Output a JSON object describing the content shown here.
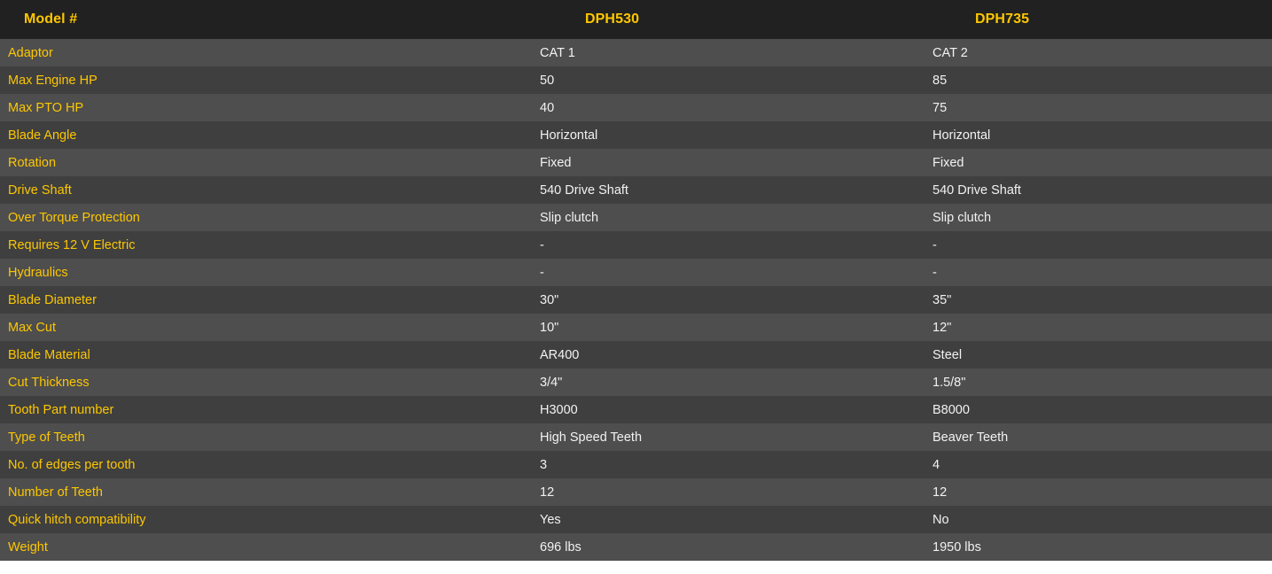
{
  "table": {
    "name": "model-specification-comparison",
    "colors": {
      "header_background": "#212121",
      "row_odd_background": "#4e4e4e",
      "row_even_background": "#3f3f3f",
      "label_text": "#fdc700",
      "value_text": "#f2f2f2",
      "page_background": "#ffffff"
    },
    "headers": {
      "label": "Model #",
      "value1": "DPH530",
      "value2": "DPH735"
    },
    "rows": [
      {
        "label": "Adaptor",
        "value1": "CAT 1",
        "value2": "CAT 2"
      },
      {
        "label": "Max Engine HP",
        "value1": "50",
        "value2": "85"
      },
      {
        "label": "Max PTO HP",
        "value1": "40",
        "value2": "75"
      },
      {
        "label": "Blade Angle",
        "value1": "Horizontal",
        "value2": "Horizontal"
      },
      {
        "label": "Rotation",
        "value1": "Fixed",
        "value2": "Fixed"
      },
      {
        "label": "Drive Shaft",
        "value1": "540 Drive Shaft",
        "value2": "540 Drive Shaft"
      },
      {
        "label": "Over Torque Protection",
        "value1": "Slip clutch",
        "value2": "Slip clutch"
      },
      {
        "label": "Requires 12 V Electric",
        "value1": "-",
        "value2": "-"
      },
      {
        "label": "Hydraulics",
        "value1": "-",
        "value2": "-"
      },
      {
        "label": "Blade Diameter",
        "value1": "30\"",
        "value2": "35\""
      },
      {
        "label": "Max Cut",
        "value1": "10\"",
        "value2": "12\""
      },
      {
        "label": "Blade Material",
        "value1": "AR400",
        "value2": "Steel"
      },
      {
        "label": "Cut Thickness",
        "value1": "3/4\"",
        "value2": "1.5/8\""
      },
      {
        "label": "Tooth Part number",
        "value1": "H3000",
        "value2": "B8000"
      },
      {
        "label": "Type of Teeth",
        "value1": "High Speed Teeth",
        "value2": "Beaver Teeth"
      },
      {
        "label": "No. of edges per tooth",
        "value1": "3",
        "value2": "4"
      },
      {
        "label": "Number of Teeth",
        "value1": "12",
        "value2": "12"
      },
      {
        "label": "Quick hitch compatibility",
        "value1": "Yes",
        "value2": "No"
      },
      {
        "label": "Weight",
        "value1": "696 lbs",
        "value2": "1950 lbs"
      }
    ]
  }
}
